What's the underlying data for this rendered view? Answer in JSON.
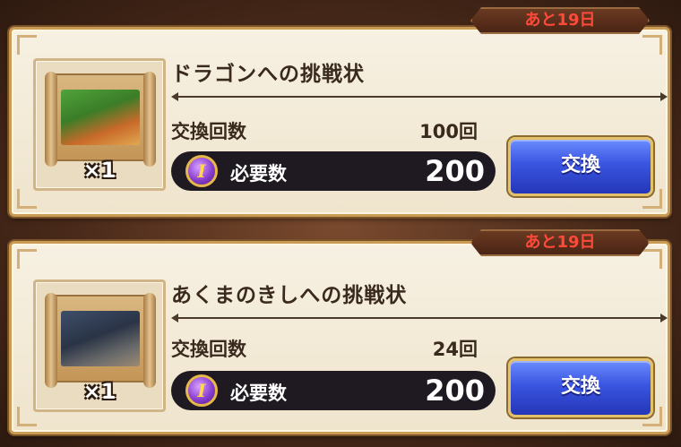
{
  "items": [
    {
      "deadline": "あと19日",
      "title": "ドラゴンへの挑戦状",
      "quantity": "×1",
      "count_label": "交換回数",
      "count_value": "100回",
      "cost_label": "必要数",
      "cost_value": "200",
      "coin_icon": "I",
      "button_label": "交換",
      "icon": "dragon-scroll-icon"
    },
    {
      "deadline": "あと19日",
      "title": "あくまのきしへの挑戦状",
      "quantity": "×1",
      "count_label": "交換回数",
      "count_value": "24回",
      "cost_label": "必要数",
      "cost_value": "200",
      "coin_icon": "I",
      "button_label": "交換",
      "icon": "demon-knight-scroll-icon"
    }
  ],
  "colors": {
    "deadline_text": "#ff4a3a",
    "button": "#3a55e0",
    "card_bg": "#f7f1e3",
    "coin": "#8a3fd0"
  }
}
